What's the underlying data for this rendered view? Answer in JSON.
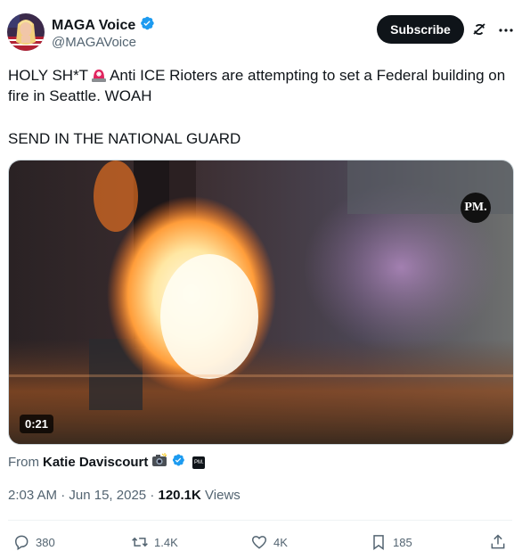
{
  "author": {
    "name": "MAGA Voice",
    "handle": "@MAGAVoice",
    "verified_color": "#1d9bf0"
  },
  "header": {
    "subscribe_label": "Subscribe"
  },
  "tweet": {
    "line1_before": "HOLY SH*T",
    "line1_after": "Anti ICE Rioters are attempting to set a Federal building on fire in Seattle. WOAH",
    "line2": "SEND IN THE NATIONAL GUARD"
  },
  "media": {
    "duration": "0:21",
    "watermark": "PM."
  },
  "source": {
    "prefix": "From",
    "name": "Katie Daviscourt",
    "badge": "PM."
  },
  "meta": {
    "time": "2:03 AM",
    "separator": "·",
    "date": "Jun 15, 2025",
    "views_count": "120.1K",
    "views_label": "Views"
  },
  "actions": {
    "replies": "380",
    "reposts": "1.4K",
    "likes": "4K",
    "bookmarks": "185"
  },
  "icons": {
    "reply": "reply-icon",
    "repost": "repost-icon",
    "like": "heart-icon",
    "bookmark": "bookmark-icon",
    "share": "share-icon",
    "grok": "grok-icon",
    "more": "more-icon",
    "verified": "verified-badge-icon",
    "siren": "siren-emoji-icon",
    "camera": "camera-emoji-icon"
  }
}
